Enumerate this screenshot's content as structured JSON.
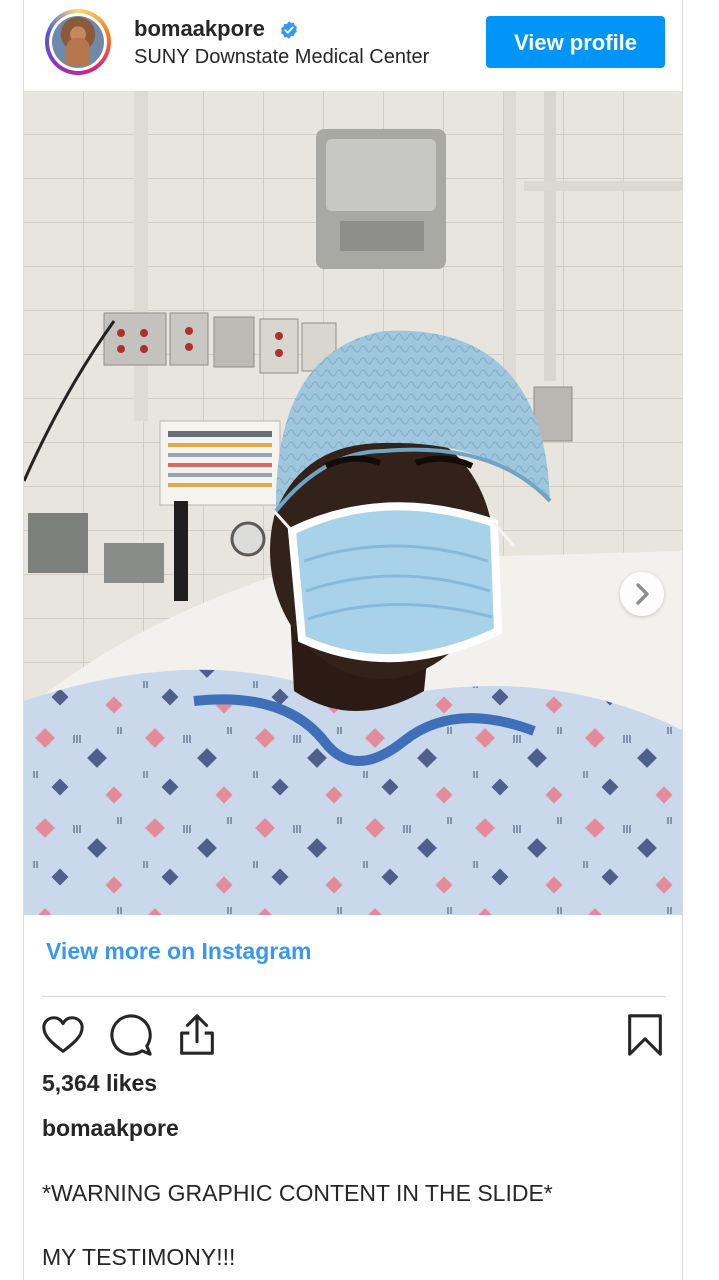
{
  "post": {
    "username": "bomaakpore",
    "location": "SUNY Downstate Medical Center",
    "view_profile_label": "View profile",
    "view_more_label": "View more on Instagram",
    "likes": "5,364 likes",
    "caption_username": "bomaakpore",
    "caption_lines": [
      "*WARNING GRAPHIC CONTENT IN THE SLIDE*",
      "MY TESTIMONY!!!"
    ]
  },
  "icons": {
    "verified": "verified-badge-icon",
    "like": "heart-icon",
    "comment": "comment-icon",
    "share": "share-icon",
    "save": "bookmark-icon",
    "next": "chevron-right-icon"
  },
  "colors": {
    "primary_button": "#0095f6",
    "link": "#3897f0",
    "verified": "#3897f0",
    "text": "#262626"
  }
}
